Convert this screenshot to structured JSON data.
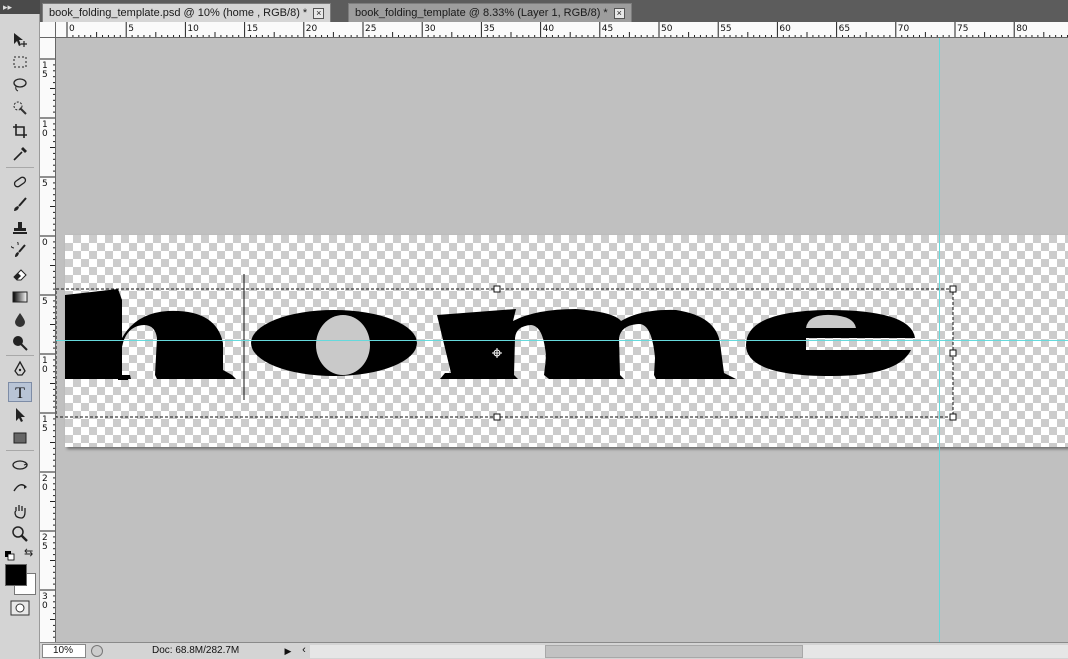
{
  "tabs": [
    {
      "label": "book_folding_template.psd @ 10% (home , RGB/8) *",
      "close": "×",
      "active": true
    },
    {
      "label": "book_folding_template @ 8.33% (Layer 1, RGB/8) *",
      "close": "×",
      "active": false
    }
  ],
  "toolbox": {
    "grip": "▸▸",
    "tools": [
      {
        "name": "move-tool-icon"
      },
      {
        "name": "marquee-tool-icon"
      },
      {
        "name": "lasso-tool-icon"
      },
      {
        "name": "quick-select-tool-icon"
      },
      {
        "name": "crop-tool-icon"
      },
      {
        "name": "eyedropper-tool-icon"
      },
      {
        "name": "healing-brush-tool-icon"
      },
      {
        "name": "brush-tool-icon"
      },
      {
        "name": "clone-stamp-tool-icon"
      },
      {
        "name": "history-brush-tool-icon"
      },
      {
        "name": "eraser-tool-icon"
      },
      {
        "name": "gradient-tool-icon"
      },
      {
        "name": "blur-tool-icon"
      },
      {
        "name": "dodge-tool-icon"
      },
      {
        "name": "pen-tool-icon"
      },
      {
        "name": "type-tool-icon",
        "active": true
      },
      {
        "name": "path-select-tool-icon"
      },
      {
        "name": "rectangle-tool-icon"
      },
      {
        "name": "3d-rotate-tool-icon"
      },
      {
        "name": "3d-orbit-tool-icon"
      },
      {
        "name": "hand-tool-icon"
      },
      {
        "name": "zoom-tool-icon"
      }
    ],
    "foreground_color": "#000000",
    "background_color": "#ffffff"
  },
  "rulers": {
    "top_labels": [
      "0",
      "5",
      "10",
      "15",
      "20",
      "25",
      "30",
      "35",
      "40",
      "45",
      "50",
      "55",
      "60",
      "65",
      "70",
      "75",
      "80"
    ],
    "left_labels": [
      "1\n5",
      "1\n0",
      "5",
      "0",
      "5",
      "1\n0",
      "1\n5",
      "2\n0",
      "2\n5",
      "3\n0",
      "3"
    ]
  },
  "canvas": {
    "text_layer": "home",
    "guide_color": "#66d9dc"
  },
  "status": {
    "zoom": "10%",
    "doc_info": "Doc: 68.8M/282.7M",
    "arrow": "▶",
    "scroll_left": "‹"
  }
}
